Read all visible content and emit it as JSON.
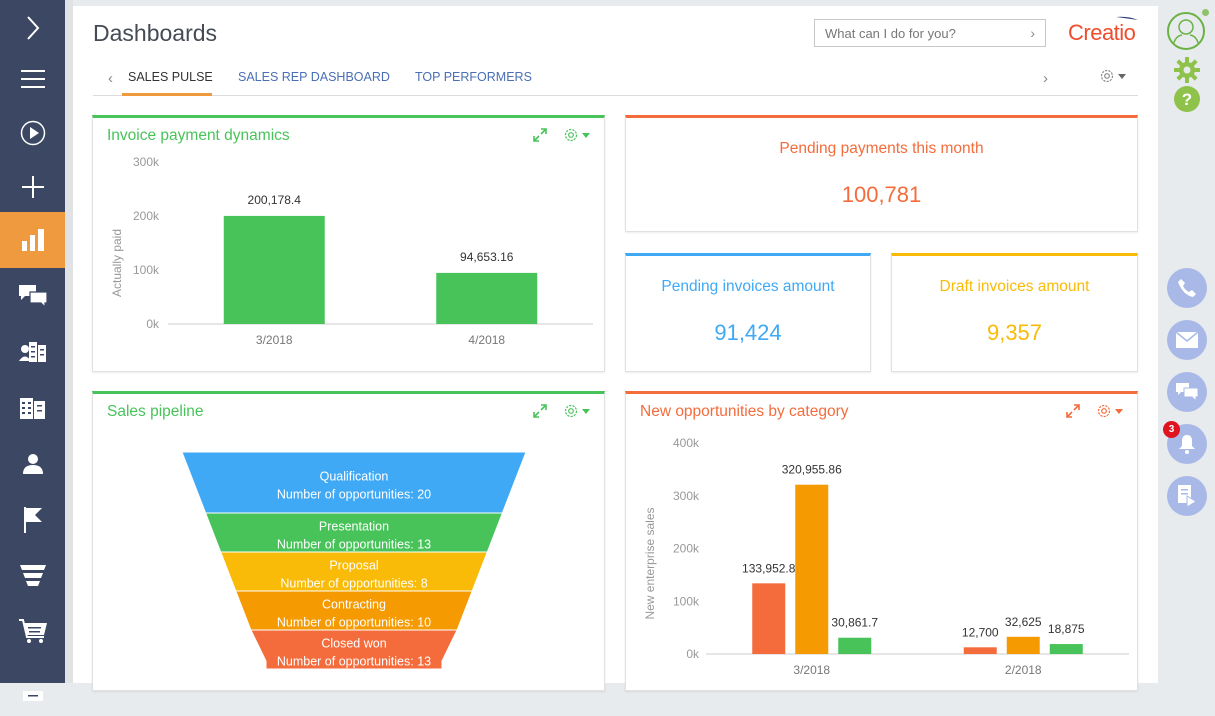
{
  "app": {
    "title": "Dashboards",
    "logo": "Creatio"
  },
  "colors": {
    "sidebar": "#3c4863",
    "active_orange": "#ef9a3e",
    "green": "#48c35a",
    "orange_red": "#f46c3c",
    "blue": "#3fa9f5",
    "yellow": "#f9bb07",
    "orange": "#f59a00",
    "link_blue": "#4a6fb5",
    "rail_button": "#a8b9e8"
  },
  "sidebar": {
    "items": [
      {
        "name": "expand",
        "icon": "chevron-right-icon"
      },
      {
        "name": "menu",
        "icon": "hamburger-icon"
      },
      {
        "name": "processes",
        "icon": "play-circle-icon"
      },
      {
        "name": "add",
        "icon": "plus-icon"
      },
      {
        "name": "dashboards",
        "icon": "bar-chart-icon",
        "active": true
      },
      {
        "name": "feed",
        "icon": "chat-icon"
      },
      {
        "name": "contacts",
        "icon": "contacts-icon"
      },
      {
        "name": "accounts",
        "icon": "buildings-icon"
      },
      {
        "name": "users",
        "icon": "person-icon"
      },
      {
        "name": "leads",
        "icon": "flag-icon"
      },
      {
        "name": "opportunities",
        "icon": "funnel-icon"
      },
      {
        "name": "orders",
        "icon": "cart-icon"
      },
      {
        "name": "documents",
        "icon": "document-icon"
      }
    ]
  },
  "header": {
    "search_placeholder": "What can I do for you?"
  },
  "tabs": {
    "items": [
      {
        "label": "SALES PULSE",
        "active": true
      },
      {
        "label": "SALES REP DASHBOARD"
      },
      {
        "label": "TOP PERFORMERS"
      }
    ]
  },
  "widgets": {
    "invoice": {
      "title": "Invoice payment dynamics"
    },
    "pending_payments": {
      "title": "Pending payments this month",
      "value": "100,781"
    },
    "pending_invoices": {
      "title": "Pending invoices amount",
      "value": "91,424"
    },
    "draft_invoices": {
      "title": "Draft invoices amount",
      "value": "9,357"
    },
    "pipeline": {
      "title": "Sales pipeline"
    },
    "opportunities": {
      "title": "New opportunities by category"
    }
  },
  "chart_data": [
    {
      "type": "bar",
      "title": "Invoice payment dynamics",
      "categories": [
        "3/2018",
        "4/2018"
      ],
      "values": [
        200178.4,
        94653.16
      ],
      "value_labels": [
        "200,178.4",
        "94,653.16"
      ],
      "xlabel": "",
      "ylabel": "Actually paid",
      "ylim": [
        0,
        300000
      ],
      "yticks": [
        "0k",
        "100k",
        "200k",
        "300k"
      ],
      "color": "#48c35a",
      "grid": false
    },
    {
      "type": "funnel",
      "title": "Sales pipeline",
      "stages": [
        {
          "label": "Qualification",
          "text": "Number of opportunities: 20",
          "value": 20,
          "color": "#3fa9f5"
        },
        {
          "label": "Presentation",
          "text": "Number of opportunities: 13",
          "value": 13,
          "color": "#48c35a"
        },
        {
          "label": "Proposal",
          "text": "Number of opportunities: 8",
          "value": 8,
          "color": "#f9bb07"
        },
        {
          "label": "Contracting",
          "text": "Number of opportunities: 10",
          "value": 10,
          "color": "#f59a00"
        },
        {
          "label": "Closed won",
          "text": "Number of opportunities: 13",
          "value": 13,
          "color": "#f46c3c"
        }
      ]
    },
    {
      "type": "bar",
      "title": "New opportunities by category",
      "categories": [
        "3/2018",
        "2/2018"
      ],
      "series": [
        {
          "name": "series-1",
          "color": "#f46c3c",
          "values": [
            133952.8,
            12700
          ],
          "value_labels": [
            "133,952.8",
            "12,700"
          ]
        },
        {
          "name": "series-2",
          "color": "#f59a00",
          "values": [
            320955.86,
            32625
          ],
          "value_labels": [
            "320,955.86",
            "32,625"
          ]
        },
        {
          "name": "series-3",
          "color": "#48c35a",
          "values": [
            30861.7,
            18875
          ],
          "value_labels": [
            "30,861.7",
            "18,875"
          ]
        }
      ],
      "xlabel": "",
      "ylabel": "New enterprise sales",
      "ylim": [
        0,
        400000
      ],
      "yticks": [
        "0k",
        "100k",
        "200k",
        "300k",
        "400k"
      ],
      "grid": false
    }
  ],
  "rail": {
    "notifications_count": "3",
    "buttons": [
      "phone-icon",
      "email-icon",
      "chat-icon",
      "bell-icon",
      "document-play-icon"
    ]
  }
}
